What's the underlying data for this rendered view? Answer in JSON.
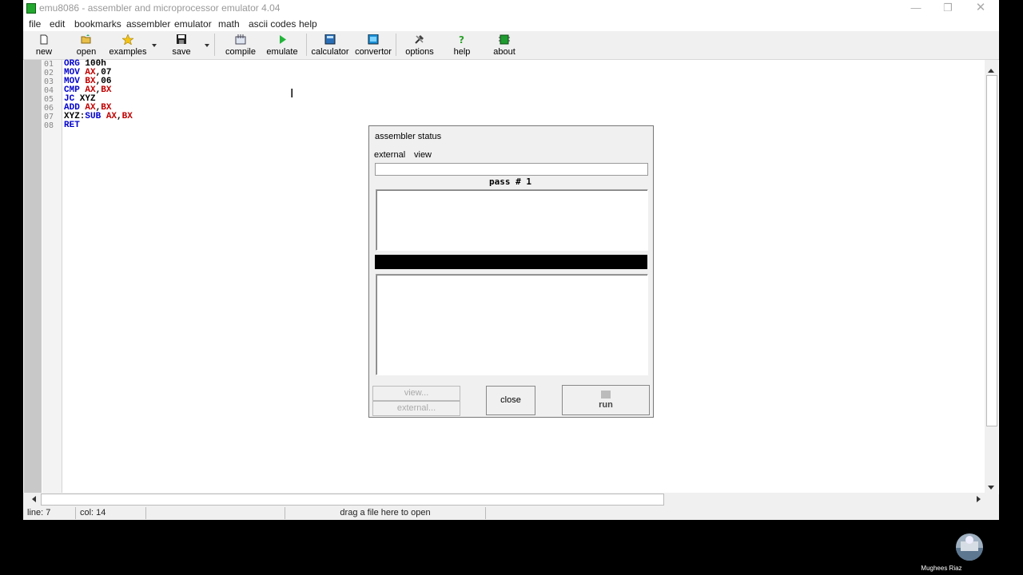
{
  "window": {
    "title": "emu8086 - assembler and microprocessor emulator 4.04"
  },
  "menu": [
    "file",
    "edit",
    "bookmarks",
    "assembler",
    "emulator",
    "math",
    "ascii codes",
    "help"
  ],
  "toolbar": {
    "new": "new",
    "open": "open",
    "examples": "examples",
    "save": "save",
    "compile": "compile",
    "emulate": "emulate",
    "calculator": "calculator",
    "convertor": "convertor",
    "options": "options",
    "help": "help",
    "about": "about"
  },
  "editor": {
    "line_numbers": [
      "01",
      "02",
      "03",
      "04",
      "05",
      "06",
      "07",
      "08"
    ],
    "lines": [
      [
        {
          "t": "ORG",
          "c": "kw"
        },
        {
          "t": " 100h",
          "c": "num"
        }
      ],
      [
        {
          "t": "MOV",
          "c": "kw"
        },
        {
          "t": " ",
          "c": "num"
        },
        {
          "t": "AX",
          "c": "reg"
        },
        {
          "t": ",07",
          "c": "num"
        }
      ],
      [
        {
          "t": "MOV",
          "c": "kw"
        },
        {
          "t": " ",
          "c": "num"
        },
        {
          "t": "BX",
          "c": "reg"
        },
        {
          "t": ",06",
          "c": "num"
        }
      ],
      [
        {
          "t": "CMP",
          "c": "kw"
        },
        {
          "t": " ",
          "c": "num"
        },
        {
          "t": "AX",
          "c": "reg"
        },
        {
          "t": ",",
          "c": "num"
        },
        {
          "t": "BX",
          "c": "reg"
        }
      ],
      [
        {
          "t": "JC",
          "c": "kw"
        },
        {
          "t": " XYZ",
          "c": "lab"
        }
      ],
      [
        {
          "t": "ADD",
          "c": "kw"
        },
        {
          "t": " ",
          "c": "num"
        },
        {
          "t": "AX",
          "c": "reg"
        },
        {
          "t": ",",
          "c": "num"
        },
        {
          "t": "BX",
          "c": "reg"
        }
      ],
      [
        {
          "t": "XYZ:",
          "c": "lab"
        },
        {
          "t": "SUB",
          "c": "kw"
        },
        {
          "t": " ",
          "c": "num"
        },
        {
          "t": "AX",
          "c": "reg"
        },
        {
          "t": ",",
          "c": "num"
        },
        {
          "t": "BX",
          "c": "reg"
        }
      ],
      [
        {
          "t": "RET",
          "c": "kw"
        }
      ]
    ]
  },
  "statusbar": {
    "line": "line: 7",
    "col": "col: 14",
    "hint": "drag a file here to open"
  },
  "dialog": {
    "title": "assembler status",
    "menu_external": "external",
    "menu_view": "view",
    "pass": "pass # 1",
    "view_button": "view...",
    "external_button": "external...",
    "close_button": "close",
    "run_button": "run"
  },
  "user": {
    "name": "Mughees Riaz"
  },
  "colors": {
    "keyword": "#0000cc",
    "register": "#c00000",
    "icon_green": "#22a82e"
  }
}
